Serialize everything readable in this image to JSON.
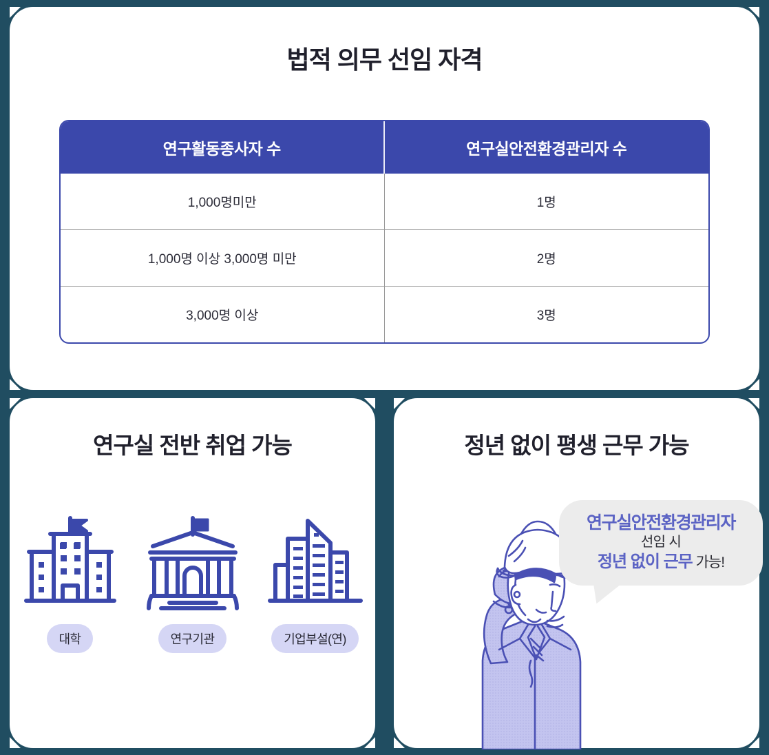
{
  "theme": {
    "page_bg": "#204d61",
    "card_bg": "#ffffff",
    "accent_blue": "#3b48ab",
    "accent_violet": "#5b63c4",
    "pill_bg": "#d5d6f5",
    "bubble_bg": "#ececec",
    "heading_color": "#20202c",
    "divider_gray": "#9a9a9a"
  },
  "top_card": {
    "title": "법적 의무 선임 자격",
    "table": {
      "headers": [
        "연구활동종사자 수",
        "연구실안전환경관리자 수"
      ],
      "rows": [
        [
          "1,000명미만",
          "1명"
        ],
        [
          "1,000명 이상 3,000명 미만",
          "2명"
        ],
        [
          "3,000명 이상",
          "3명"
        ]
      ]
    }
  },
  "left_card": {
    "title": "연구실 전반 취업 가능",
    "institutions": [
      {
        "icon": "university-building-icon",
        "label": "대학"
      },
      {
        "icon": "research-institute-icon",
        "label": "연구기관"
      },
      {
        "icon": "corporate-skyscraper-icon",
        "label": "기업부설(연)"
      }
    ]
  },
  "right_card": {
    "title": "정년 없이 평생 근무 가능",
    "illustration": "safety-worker-fist-icon",
    "speech_bubble": {
      "line1": "연구실안전환경관리자",
      "line2": "선임 시",
      "line3_highlight": "정년 없이 근무",
      "line3_plain": " 가능!"
    }
  }
}
